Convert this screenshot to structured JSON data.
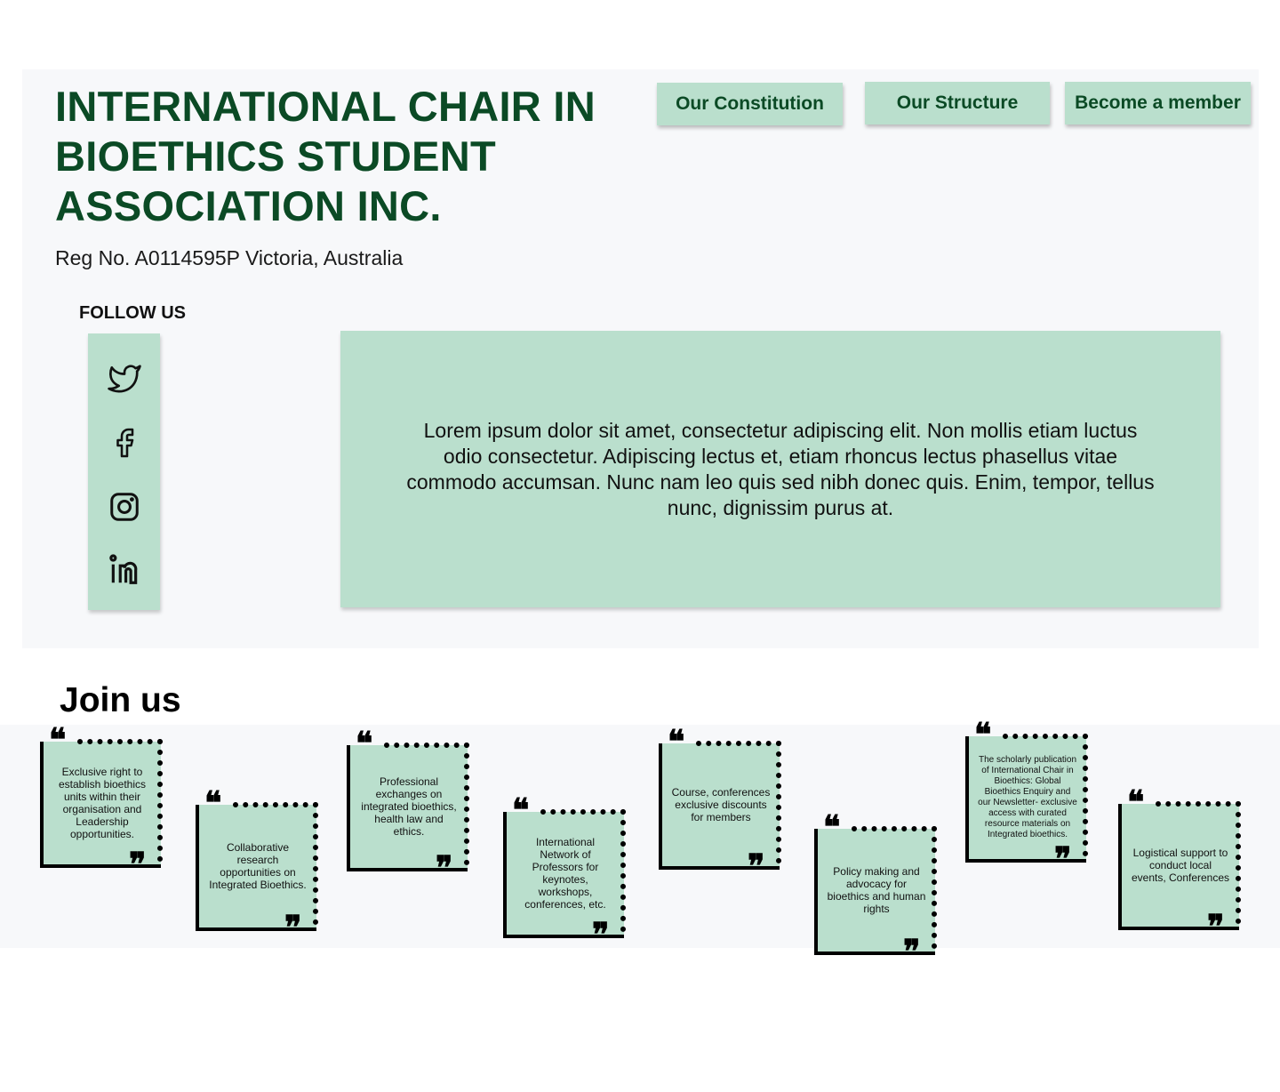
{
  "header": {
    "title": "INTERNATIONAL CHAIR IN BIOETHICS STUDENT ASSOCIATION INC.",
    "reg": "Reg No. A0114595P Victoria, Australia"
  },
  "nav": {
    "constitution": "Our Constitution",
    "structure": "Our Structure",
    "member": "Become a member"
  },
  "follow": {
    "label": "FOLLOW US",
    "icons": [
      "twitter-icon",
      "facebook-icon",
      "instagram-icon",
      "linkedin-icon"
    ]
  },
  "intro": {
    "text": "Lorem ipsum dolor sit amet, consectetur adipiscing elit. Non mollis etiam luctus odio consectetur. Adipiscing lectus et, etiam rhoncus lectus phasellus vitae commodo accumsan. Nunc nam leo quis sed nibh donec quis. Enim, tempor, tellus nunc, dignissim purus at."
  },
  "join": {
    "title": "Join us",
    "cards": [
      "Exclusive right to establish bioethics units within their organisation and Leadership opportunities.",
      "Collaborative research opportunities on Integrated Bioethics.",
      "Professional exchanges on integrated bioethics, health law and ethics.",
      "International Network of Professors for keynotes, workshops, conferences, etc.",
      "Course, conferences exclusive discounts for members",
      "Policy making and advocacy for bioethics and human rights",
      "The scholarly publication of International Chair in Bioethics: Global Bioethics Enquiry and our Newsletter- exclusive access with curated resource materials on Integrated bioethics.",
      "Logistical support to conduct local events, Conferences"
    ]
  },
  "colors": {
    "brand_green": "#0b4a25",
    "mint": "#badfcd",
    "panel_bg": "#f7f8fa"
  }
}
